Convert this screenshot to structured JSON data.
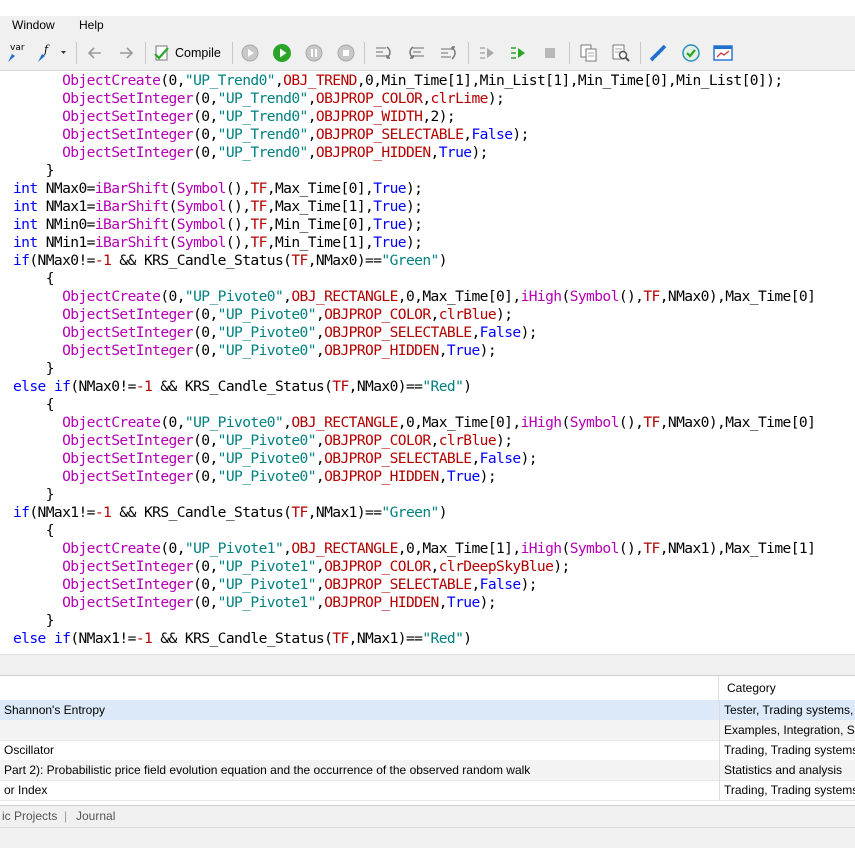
{
  "menu": {
    "window": "Window",
    "help": "Help"
  },
  "toolbar": {
    "var_label": "var",
    "compile_label": "Compile"
  },
  "editor": {
    "lines": [
      [
        [
          "      ",
          ""
        ],
        [
          "ObjectCreate",
          "f"
        ],
        [
          "(0,",
          ""
        ],
        [
          "\"UP_Trend0\"",
          "s"
        ],
        [
          ",",
          ""
        ],
        [
          "OBJ_TREND",
          "c"
        ],
        [
          ",0,Min_Time[1],Min_List[1],Min_Time[0],Min_List[0]);",
          ""
        ]
      ],
      [
        [
          "      ",
          ""
        ],
        [
          "ObjectSetInteger",
          "f"
        ],
        [
          "(0,",
          ""
        ],
        [
          "\"UP_Trend0\"",
          "s"
        ],
        [
          ",",
          ""
        ],
        [
          "OBJPROP_COLOR",
          "c"
        ],
        [
          ",",
          ""
        ],
        [
          "clrLime",
          "c"
        ],
        [
          ");",
          ""
        ]
      ],
      [
        [
          "      ",
          ""
        ],
        [
          "ObjectSetInteger",
          "f"
        ],
        [
          "(0,",
          ""
        ],
        [
          "\"UP_Trend0\"",
          "s"
        ],
        [
          ",",
          ""
        ],
        [
          "OBJPROP_WIDTH",
          "c"
        ],
        [
          ",2);",
          ""
        ]
      ],
      [
        [
          "      ",
          ""
        ],
        [
          "ObjectSetInteger",
          "f"
        ],
        [
          "(0,",
          ""
        ],
        [
          "\"UP_Trend0\"",
          "s"
        ],
        [
          ",",
          ""
        ],
        [
          "OBJPROP_SELECTABLE",
          "c"
        ],
        [
          ",",
          ""
        ],
        [
          "False",
          "k"
        ],
        [
          ");",
          ""
        ]
      ],
      [
        [
          "      ",
          ""
        ],
        [
          "ObjectSetInteger",
          "f"
        ],
        [
          "(0,",
          ""
        ],
        [
          "\"UP_Trend0\"",
          "s"
        ],
        [
          ",",
          ""
        ],
        [
          "OBJPROP_HIDDEN",
          "c"
        ],
        [
          ",",
          ""
        ],
        [
          "True",
          "k"
        ],
        [
          ");",
          ""
        ]
      ],
      [
        [
          "    }",
          ""
        ]
      ],
      [
        [
          "int",
          "k"
        ],
        [
          " NMax0=",
          ""
        ],
        [
          "iBarShift",
          "f"
        ],
        [
          "(",
          ""
        ],
        [
          "Symbol",
          "f"
        ],
        [
          "(),",
          ""
        ],
        [
          "TF",
          "c"
        ],
        [
          ",Max_Time[0],",
          ""
        ],
        [
          "True",
          "k"
        ],
        [
          ");",
          ""
        ]
      ],
      [
        [
          "int",
          "k"
        ],
        [
          " NMax1=",
          ""
        ],
        [
          "iBarShift",
          "f"
        ],
        [
          "(",
          ""
        ],
        [
          "Symbol",
          "f"
        ],
        [
          "(),",
          ""
        ],
        [
          "TF",
          "c"
        ],
        [
          ",Max_Time[1],",
          ""
        ],
        [
          "True",
          "k"
        ],
        [
          ");",
          ""
        ]
      ],
      [
        [
          "int",
          "k"
        ],
        [
          " NMin0=",
          ""
        ],
        [
          "iBarShift",
          "f"
        ],
        [
          "(",
          ""
        ],
        [
          "Symbol",
          "f"
        ],
        [
          "(),",
          ""
        ],
        [
          "TF",
          "c"
        ],
        [
          ",Min_Time[0],",
          ""
        ],
        [
          "True",
          "k"
        ],
        [
          ");",
          ""
        ]
      ],
      [
        [
          "int",
          "k"
        ],
        [
          " NMin1=",
          ""
        ],
        [
          "iBarShift",
          "f"
        ],
        [
          "(",
          ""
        ],
        [
          "Symbol",
          "f"
        ],
        [
          "(),",
          ""
        ],
        [
          "TF",
          "c"
        ],
        [
          ",Min_Time[1],",
          ""
        ],
        [
          "True",
          "k"
        ],
        [
          ");",
          ""
        ]
      ],
      [
        [
          "if",
          "k"
        ],
        [
          "(NMax0!=",
          ""
        ],
        [
          "-1",
          "c"
        ],
        [
          " && KRS_Candle_Status(",
          ""
        ],
        [
          "TF",
          "c"
        ],
        [
          ",NMax0)==",
          ""
        ],
        [
          "\"Green\"",
          "s"
        ],
        [
          ")",
          ""
        ]
      ],
      [
        [
          "    {",
          ""
        ]
      ],
      [
        [
          "      ",
          ""
        ],
        [
          "ObjectCreate",
          "f"
        ],
        [
          "(0,",
          ""
        ],
        [
          "\"UP_Pivote0\"",
          "s"
        ],
        [
          ",",
          ""
        ],
        [
          "OBJ_RECTANGLE",
          "c"
        ],
        [
          ",0,Max_Time[0],",
          ""
        ],
        [
          "iHigh",
          "f"
        ],
        [
          "(",
          ""
        ],
        [
          "Symbol",
          "f"
        ],
        [
          "(),",
          ""
        ],
        [
          "TF",
          "c"
        ],
        [
          ",NMax0),Max_Time[0]",
          ""
        ]
      ],
      [
        [
          "      ",
          ""
        ],
        [
          "ObjectSetInteger",
          "f"
        ],
        [
          "(0,",
          ""
        ],
        [
          "\"UP_Pivote0\"",
          "s"
        ],
        [
          ",",
          ""
        ],
        [
          "OBJPROP_COLOR",
          "c"
        ],
        [
          ",",
          ""
        ],
        [
          "clrBlue",
          "c"
        ],
        [
          ");",
          ""
        ]
      ],
      [
        [
          "      ",
          ""
        ],
        [
          "ObjectSetInteger",
          "f"
        ],
        [
          "(0,",
          ""
        ],
        [
          "\"UP_Pivote0\"",
          "s"
        ],
        [
          ",",
          ""
        ],
        [
          "OBJPROP_SELECTABLE",
          "c"
        ],
        [
          ",",
          ""
        ],
        [
          "False",
          "k"
        ],
        [
          ");",
          ""
        ]
      ],
      [
        [
          "      ",
          ""
        ],
        [
          "ObjectSetInteger",
          "f"
        ],
        [
          "(0,",
          ""
        ],
        [
          "\"UP_Pivote0\"",
          "s"
        ],
        [
          ",",
          ""
        ],
        [
          "OBJPROP_HIDDEN",
          "c"
        ],
        [
          ",",
          ""
        ],
        [
          "True",
          "k"
        ],
        [
          ");",
          ""
        ]
      ],
      [
        [
          "    }",
          ""
        ]
      ],
      [
        [
          "else",
          "k"
        ],
        [
          " ",
          ""
        ],
        [
          "if",
          "k"
        ],
        [
          "(NMax0!=",
          ""
        ],
        [
          "-1",
          "c"
        ],
        [
          " && KRS_Candle_Status(",
          ""
        ],
        [
          "TF",
          "c"
        ],
        [
          ",NMax0)==",
          ""
        ],
        [
          "\"Red\"",
          "s"
        ],
        [
          ")",
          ""
        ]
      ],
      [
        [
          "    {",
          ""
        ]
      ],
      [
        [
          "      ",
          ""
        ],
        [
          "ObjectCreate",
          "f"
        ],
        [
          "(0,",
          ""
        ],
        [
          "\"UP_Pivote0\"",
          "s"
        ],
        [
          ",",
          ""
        ],
        [
          "OBJ_RECTANGLE",
          "c"
        ],
        [
          ",0,Max_Time[0],",
          ""
        ],
        [
          "iHigh",
          "f"
        ],
        [
          "(",
          ""
        ],
        [
          "Symbol",
          "f"
        ],
        [
          "(),",
          ""
        ],
        [
          "TF",
          "c"
        ],
        [
          ",NMax0),Max_Time[0]",
          ""
        ]
      ],
      [
        [
          "      ",
          ""
        ],
        [
          "ObjectSetInteger",
          "f"
        ],
        [
          "(0,",
          ""
        ],
        [
          "\"UP_Pivote0\"",
          "s"
        ],
        [
          ",",
          ""
        ],
        [
          "OBJPROP_COLOR",
          "c"
        ],
        [
          ",",
          ""
        ],
        [
          "clrBlue",
          "c"
        ],
        [
          ");",
          ""
        ]
      ],
      [
        [
          "      ",
          ""
        ],
        [
          "ObjectSetInteger",
          "f"
        ],
        [
          "(0,",
          ""
        ],
        [
          "\"UP_Pivote0\"",
          "s"
        ],
        [
          ",",
          ""
        ],
        [
          "OBJPROP_SELECTABLE",
          "c"
        ],
        [
          ",",
          ""
        ],
        [
          "False",
          "k"
        ],
        [
          ");",
          ""
        ]
      ],
      [
        [
          "      ",
          ""
        ],
        [
          "ObjectSetInteger",
          "f"
        ],
        [
          "(0,",
          ""
        ],
        [
          "\"UP_Pivote0\"",
          "s"
        ],
        [
          ",",
          ""
        ],
        [
          "OBJPROP_HIDDEN",
          "c"
        ],
        [
          ",",
          ""
        ],
        [
          "True",
          "k"
        ],
        [
          ");",
          ""
        ]
      ],
      [
        [
          "    }",
          ""
        ]
      ],
      [
        [
          "if",
          "k"
        ],
        [
          "(NMax1!=",
          ""
        ],
        [
          "-1",
          "c"
        ],
        [
          " && KRS_Candle_Status(",
          ""
        ],
        [
          "TF",
          "c"
        ],
        [
          ",NMax1)==",
          ""
        ],
        [
          "\"Green\"",
          "s"
        ],
        [
          ")",
          ""
        ]
      ],
      [
        [
          "    {",
          ""
        ]
      ],
      [
        [
          "      ",
          ""
        ],
        [
          "ObjectCreate",
          "f"
        ],
        [
          "(0,",
          ""
        ],
        [
          "\"UP_Pivote1\"",
          "s"
        ],
        [
          ",",
          ""
        ],
        [
          "OBJ_RECTANGLE",
          "c"
        ],
        [
          ",0,Max_Time[1],",
          ""
        ],
        [
          "iHigh",
          "f"
        ],
        [
          "(",
          ""
        ],
        [
          "Symbol",
          "f"
        ],
        [
          "(),",
          ""
        ],
        [
          "TF",
          "c"
        ],
        [
          ",NMax1),Max_Time[1]",
          ""
        ]
      ],
      [
        [
          "      ",
          ""
        ],
        [
          "ObjectSetInteger",
          "f"
        ],
        [
          "(0,",
          ""
        ],
        [
          "\"UP_Pivote1\"",
          "s"
        ],
        [
          ",",
          ""
        ],
        [
          "OBJPROP_COLOR",
          "c"
        ],
        [
          ",",
          ""
        ],
        [
          "clrDeepSkyBlue",
          "c"
        ],
        [
          ");",
          ""
        ]
      ],
      [
        [
          "      ",
          ""
        ],
        [
          "ObjectSetInteger",
          "f"
        ],
        [
          "(0,",
          ""
        ],
        [
          "\"UP_Pivote1\"",
          "s"
        ],
        [
          ",",
          ""
        ],
        [
          "OBJPROP_SELECTABLE",
          "c"
        ],
        [
          ",",
          ""
        ],
        [
          "False",
          "k"
        ],
        [
          ");",
          ""
        ]
      ],
      [
        [
          "      ",
          ""
        ],
        [
          "ObjectSetInteger",
          "f"
        ],
        [
          "(0,",
          ""
        ],
        [
          "\"UP_Pivote1\"",
          "s"
        ],
        [
          ",",
          ""
        ],
        [
          "OBJPROP_HIDDEN",
          "c"
        ],
        [
          ",",
          ""
        ],
        [
          "True",
          "k"
        ],
        [
          ");",
          ""
        ]
      ],
      [
        [
          "    }",
          ""
        ]
      ],
      [
        [
          "else",
          "k"
        ],
        [
          " ",
          ""
        ],
        [
          "if",
          "k"
        ],
        [
          "(NMax1!=",
          ""
        ],
        [
          "-1",
          "c"
        ],
        [
          " && KRS_Candle_Status(",
          ""
        ],
        [
          "TF",
          "c"
        ],
        [
          ",NMax1)==",
          ""
        ],
        [
          "\"Red\"",
          "s"
        ],
        [
          ")",
          ""
        ]
      ]
    ]
  },
  "articles": {
    "category_header": "Category",
    "rows": [
      {
        "name": "Shannon's Entropy",
        "category": "Tester, Trading systems, E"
      },
      {
        "name": "",
        "category": "Examples, Integration, St"
      },
      {
        "name": "Oscillator",
        "category": "Trading, Trading systems"
      },
      {
        "name": "Part 2): Probabilistic price field evolution equation and the occurrence of the observed random walk",
        "category": "Statistics and analysis"
      },
      {
        "name": "or Index",
        "category": "Trading, Trading systems"
      }
    ]
  },
  "bottom_tabs": {
    "projects": "ic Projects",
    "journal": "Journal"
  },
  "colors": {
    "keyword": "#0000ff",
    "function": "#b400b4",
    "constant": "#b40000",
    "string": "#008080",
    "play": "#2aa52a"
  }
}
